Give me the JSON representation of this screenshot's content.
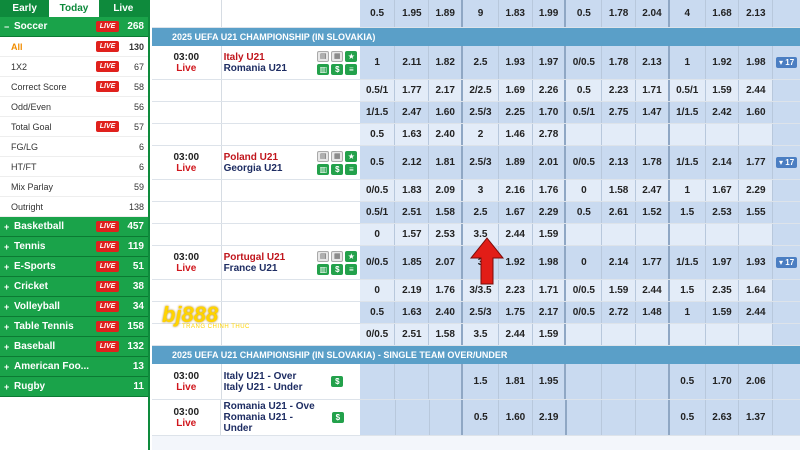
{
  "sidebar": {
    "tabs": [
      {
        "label": "Early",
        "active": false
      },
      {
        "label": "Today",
        "active": true
      },
      {
        "label": "Live",
        "active": false
      }
    ],
    "soccer": {
      "label": "Soccer",
      "count": "268",
      "live": "LIVE"
    },
    "soccer_items": [
      {
        "label": "All",
        "count": "130",
        "live": "LIVE",
        "active": true
      },
      {
        "label": "1X2",
        "count": "67",
        "live": "LIVE"
      },
      {
        "label": "Correct Score",
        "count": "58",
        "live": "LIVE"
      },
      {
        "label": "Odd/Even",
        "count": "56",
        "live": ""
      },
      {
        "label": "Total Goal",
        "count": "57",
        "live": "LIVE"
      },
      {
        "label": "FG/LG",
        "count": "6",
        "live": ""
      },
      {
        "label": "HT/FT",
        "count": "6",
        "live": ""
      },
      {
        "label": "Mix Parlay",
        "count": "59",
        "live": ""
      },
      {
        "label": "Outright",
        "count": "138",
        "live": ""
      }
    ],
    "sports": [
      {
        "label": "Basketball",
        "count": "457",
        "live": "LIVE"
      },
      {
        "label": "Tennis",
        "count": "119",
        "live": "LIVE"
      },
      {
        "label": "E-Sports",
        "count": "51",
        "live": "LIVE"
      },
      {
        "label": "Cricket",
        "count": "38",
        "live": "LIVE"
      },
      {
        "label": "Volleyball",
        "count": "34",
        "live": "LIVE"
      },
      {
        "label": "Table Tennis",
        "count": "158",
        "live": "LIVE"
      },
      {
        "label": "Baseball",
        "count": "132",
        "live": "LIVE"
      },
      {
        "label": "American Foo...",
        "count": "13",
        "live": ""
      },
      {
        "label": "Rugby",
        "count": "11",
        "live": ""
      }
    ]
  },
  "main": {
    "top_row": [
      "0.5",
      "1.95",
      "1.89",
      "9",
      "1.83",
      "1.99",
      "0.5",
      "1.78",
      "2.04",
      "4",
      "1.68",
      "2.13"
    ],
    "league1": "2025 UEFA U21 CHAMPIONSHIP (IN SLOVAKIA)",
    "match1": {
      "time": "03:00",
      "status": "Live",
      "home": "Italy U21",
      "away": "Romania U21",
      "more": "▾ 17",
      "rows": [
        [
          "1",
          "2.11",
          "1.82",
          "2.5",
          "1.93",
          "1.97",
          "0/0.5",
          "1.78",
          "2.13",
          "1",
          "1.92",
          "1.98"
        ],
        [
          "0.5/1",
          "1.77",
          "2.17",
          "2/2.5",
          "1.69",
          "2.26",
          "0.5",
          "2.23",
          "1.71",
          "0.5/1",
          "1.59",
          "2.44"
        ],
        [
          "1/1.5",
          "2.47",
          "1.60",
          "2.5/3",
          "2.25",
          "1.70",
          "0.5/1",
          "2.75",
          "1.47",
          "1/1.5",
          "2.42",
          "1.60"
        ],
        [
          "0.5",
          "1.63",
          "2.40",
          "2",
          "1.46",
          "2.78",
          "",
          "",
          "",
          "",
          "",
          ""
        ]
      ]
    },
    "match2": {
      "time": "03:00",
      "status": "Live",
      "home": "Poland U21",
      "away": "Georgia U21",
      "more": "▾ 17",
      "rows": [
        [
          "0.5",
          "2.12",
          "1.81",
          "2.5/3",
          "1.89",
          "2.01",
          "0/0.5",
          "2.13",
          "1.78",
          "1/1.5",
          "2.14",
          "1.77"
        ],
        [
          "0/0.5",
          "1.83",
          "2.09",
          "3",
          "2.16",
          "1.76",
          "0",
          "1.58",
          "2.47",
          "1",
          "1.67",
          "2.29"
        ],
        [
          "0.5/1",
          "2.51",
          "1.58",
          "2.5",
          "1.67",
          "2.29",
          "0.5",
          "2.61",
          "1.52",
          "1.5",
          "2.53",
          "1.55"
        ],
        [
          "0",
          "1.57",
          "2.53",
          "3.5",
          "2.44",
          "1.59",
          "",
          "",
          "",
          "",
          "",
          ""
        ]
      ]
    },
    "match3": {
      "time": "03:00",
      "status": "Live",
      "home": "Portugal U21",
      "away": "France U21",
      "more": "▾ 17",
      "rows": [
        [
          "0/0.5",
          "1.85",
          "2.07",
          "3",
          "1.92",
          "1.98",
          "0",
          "2.14",
          "1.77",
          "1/1.5",
          "1.97",
          "1.93"
        ],
        [
          "0",
          "2.19",
          "1.76",
          "3/3.5",
          "2.23",
          "1.71",
          "0/0.5",
          "1.59",
          "2.44",
          "1.5",
          "2.35",
          "1.64"
        ],
        [
          "0.5",
          "1.63",
          "2.40",
          "2.5/3",
          "1.75",
          "2.17",
          "0/0.5",
          "2.72",
          "1.48",
          "1",
          "1.59",
          "2.44"
        ],
        [
          "0/0.5",
          "2.51",
          "1.58",
          "3.5",
          "2.44",
          "1.59",
          "",
          "",
          "",
          "",
          "",
          ""
        ]
      ]
    },
    "league2": "2025 UEFA U21 CHAMPIONSHIP (IN SLOVAKIA) - SINGLE TEAM OVER/UNDER",
    "match4": {
      "time": "03:00",
      "status": "Live",
      "home": "Italy U21 - Over",
      "away": "Italy U21 - Under",
      "row": [
        "",
        "",
        "",
        "1.5",
        "1.81",
        "1.95",
        "",
        "",
        "",
        "0.5",
        "1.70",
        "2.06"
      ]
    },
    "match5": {
      "time": "03:00",
      "status": "Live",
      "home": "Romania U21 - Over",
      "away": "Romania U21 -",
      "away2": "Under",
      "row": [
        "",
        "",
        "",
        "0.5",
        "1.60",
        "2.19",
        "",
        "",
        "",
        "0.5",
        "2.63",
        "1.37"
      ]
    },
    "logo": {
      "brand": "bj888",
      "tagline": "TRANG CHINH THUC"
    },
    "colors": {
      "green": "#0e8a3c",
      "league_bar": "#5a9fc8",
      "odds_bg": "#c9daf0",
      "live_red": "#e0211d"
    }
  }
}
